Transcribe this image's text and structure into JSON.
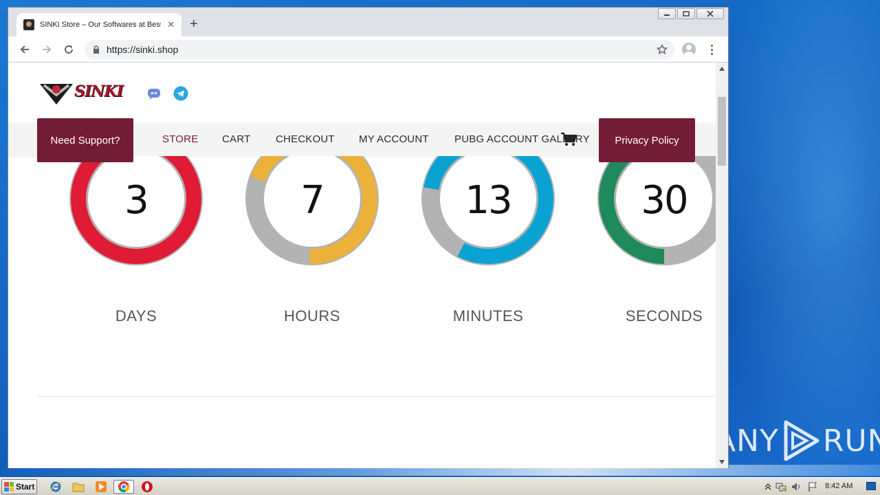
{
  "browser": {
    "tab_title": "SINKI Store – Our Softwares at Best",
    "url": "https://sinki.shop"
  },
  "site": {
    "logo_text": "SINKI",
    "nav": {
      "support_btn": "Need Support?",
      "links": [
        "STORE",
        "CART",
        "CHECKOUT",
        "MY ACCOUNT",
        "PUBG ACCOUNT GALLERY"
      ],
      "privacy_btn": "Privacy Policy"
    },
    "countdown": [
      {
        "value": "3",
        "label": "DAYS",
        "color": "#e01b35",
        "progress": 1.0
      },
      {
        "value": "7",
        "label": "HOURS",
        "color": "#ebb13a",
        "progress": 0.7
      },
      {
        "value": "13",
        "label": "MINUTES",
        "color": "#0aa2d2",
        "progress": 0.8
      },
      {
        "value": "30",
        "label": "SECONDS",
        "color": "#1f8a5a",
        "progress": 0.5
      }
    ]
  },
  "taskbar": {
    "start_label": "Start",
    "clock": "8:42 AM"
  },
  "watermark": {
    "text_left": "ANY",
    "text_right": "RUN"
  },
  "colors": {
    "brand": "#731c36",
    "ring_track": "#b3b3b3"
  }
}
